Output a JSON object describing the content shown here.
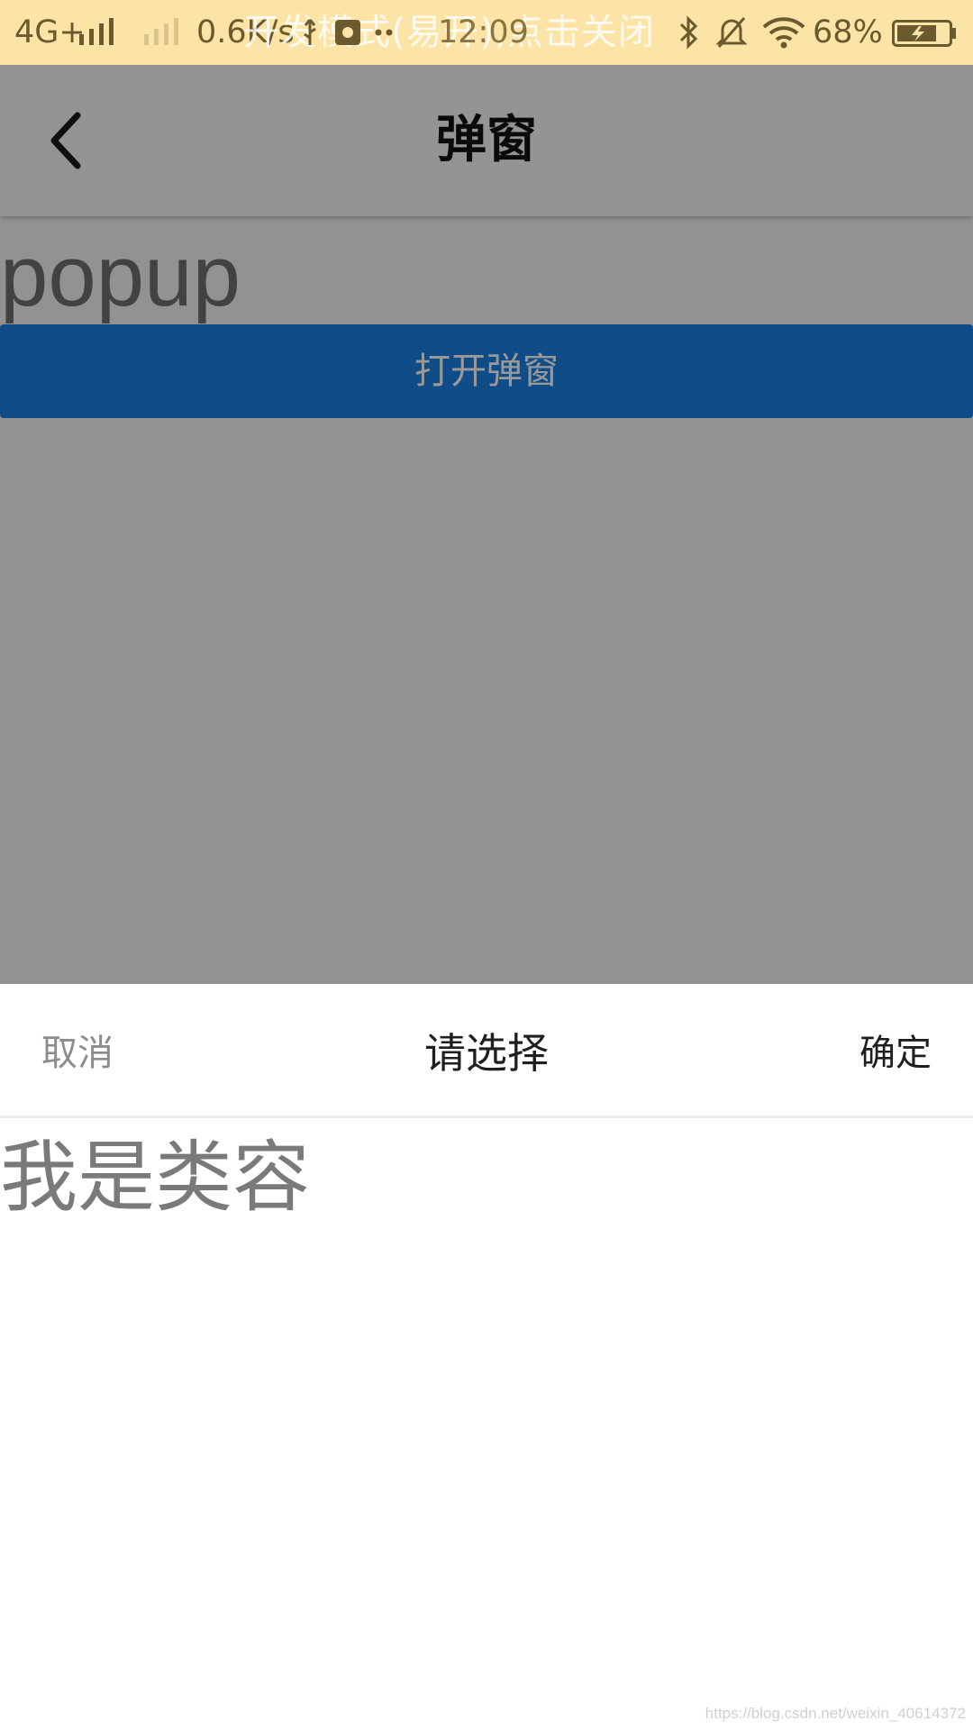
{
  "status_bar": {
    "network": "4G+",
    "speed": "0.6K/s",
    "time": "12:09",
    "dev_mode_notice": "开发模式(易开),点击关闭",
    "battery": "68%",
    "icons": [
      "signal-icon",
      "usb-icon",
      "notification-icon",
      "bluetooth-icon",
      "mute-icon",
      "wifi-icon",
      "battery-charging-icon"
    ]
  },
  "nav": {
    "title": "弹窗",
    "back_icon": "chevron-left-icon"
  },
  "page": {
    "heading": "popup",
    "open_button_label": "打开弹窗"
  },
  "popup": {
    "cancel_label": "取消",
    "title": "请选择",
    "confirm_label": "确定",
    "content": "我是类容"
  },
  "watermark": "https://blog.csdn.net/weixin_40614372",
  "colors": {
    "status_bar_bg": "#fce3a6",
    "primary_button": "#1a7fe3",
    "mask": "rgba(0,0,0,0.4)"
  }
}
